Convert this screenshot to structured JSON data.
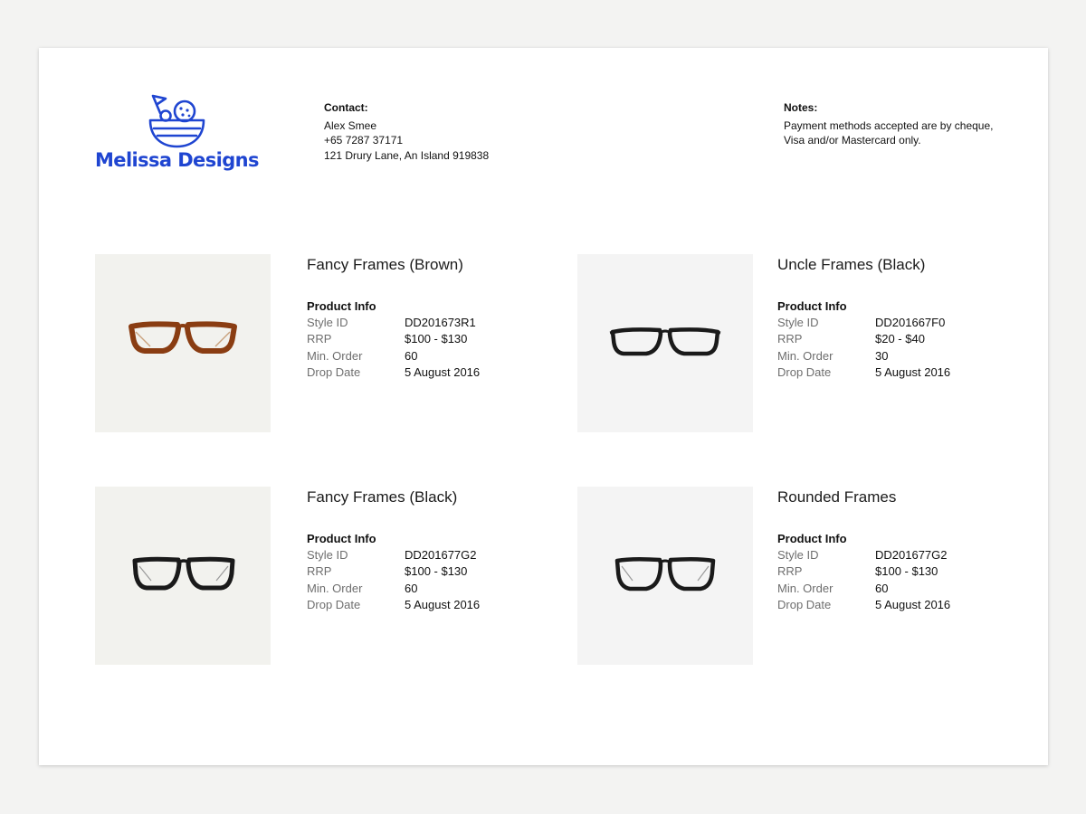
{
  "brand": {
    "name": "Melissa Designs",
    "accent_color": "#1f45d1",
    "logo_icon": "bowl-with-flag-icon"
  },
  "contact": {
    "label": "Contact:",
    "name": "Alex Smee",
    "phone": "+65 7287 37171",
    "address": "121 Drury Lane, An Island 919838"
  },
  "notes": {
    "label": "Notes:",
    "text": "Payment methods accepted are by cheque, Visa and/or Mastercard only."
  },
  "products": [
    {
      "name": "Fancy Frames (Brown)",
      "info_label": "Product Info",
      "frame_color": "#8a3d12",
      "fields": [
        {
          "label": "Style ID",
          "value": "DD201673R1"
        },
        {
          "label": "RRP",
          "value": "$100 - $130"
        },
        {
          "label": "Min. Order",
          "value": "60"
        },
        {
          "label": "Drop Date",
          "value": "5 August 2016"
        }
      ]
    },
    {
      "name": "Uncle Frames (Black)",
      "info_label": "Product Info",
      "frame_color": "#1a1a1a",
      "fields": [
        {
          "label": "Style ID",
          "value": "DD201667F0"
        },
        {
          "label": "RRP",
          "value": "$20 - $40"
        },
        {
          "label": "Min. Order",
          "value": "30"
        },
        {
          "label": "Drop Date",
          "value": "5 August 2016"
        }
      ]
    },
    {
      "name": "Fancy Frames (Black)",
      "info_label": "Product Info",
      "frame_color": "#1a1a1a",
      "fields": [
        {
          "label": "Style ID",
          "value": "DD201677G2"
        },
        {
          "label": "RRP",
          "value": "$100 - $130"
        },
        {
          "label": "Min. Order",
          "value": "60"
        },
        {
          "label": "Drop Date",
          "value": "5 August 2016"
        }
      ]
    },
    {
      "name": "Rounded Frames",
      "info_label": "Product Info",
      "frame_color": "#1a1a1a",
      "fields": [
        {
          "label": "Style ID",
          "value": "DD201677G2"
        },
        {
          "label": "RRP",
          "value": "$100 - $130"
        },
        {
          "label": "Min. Order",
          "value": "60"
        },
        {
          "label": "Drop Date",
          "value": "5 August 2016"
        }
      ]
    }
  ]
}
